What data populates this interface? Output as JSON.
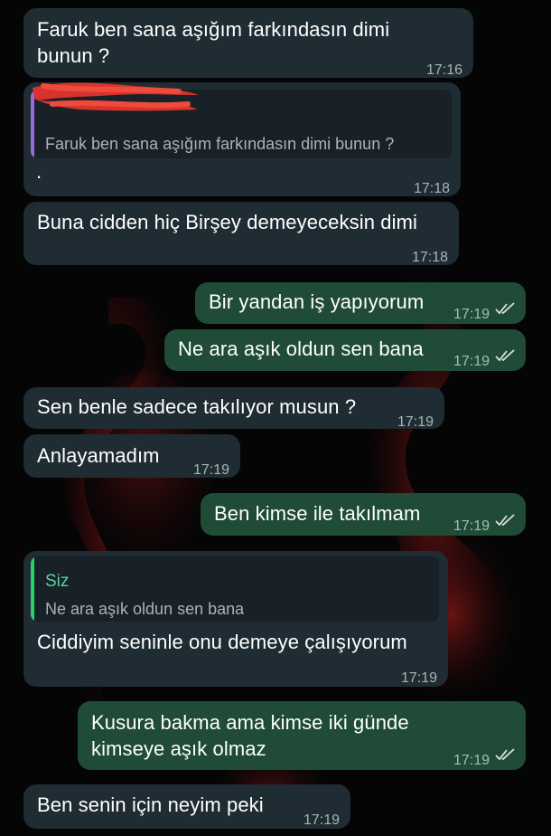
{
  "messages": [
    {
      "id": "m1",
      "direction": "incoming",
      "text": "Faruk ben sana aşığım farkındasın dimi\nbunun ?",
      "time": "17:16"
    },
    {
      "id": "m2",
      "direction": "incoming",
      "reply_quote": {
        "author": "",
        "text": "Faruk ben sana aşığım farkındasın dimi bunun ?",
        "bar_color": "#9b6bdc"
      },
      "text": ".",
      "time": "17:18"
    },
    {
      "id": "m3",
      "direction": "incoming",
      "text": "Buna cidden hiç Birşey demeyeceksin dimi",
      "time": "17:18"
    },
    {
      "id": "m4",
      "direction": "outgoing",
      "text": "Bir yandan iş yapıyorum",
      "time": "17:19",
      "status": "read"
    },
    {
      "id": "m5",
      "direction": "outgoing",
      "text": "Ne ara aşık oldun sen bana",
      "time": "17:19",
      "status": "read"
    },
    {
      "id": "m6",
      "direction": "incoming",
      "text": "Sen benle sadece takılıyor musun ?",
      "time": "17:19"
    },
    {
      "id": "m7",
      "direction": "incoming",
      "text": "Anlayamadım",
      "time": "17:19"
    },
    {
      "id": "m8",
      "direction": "outgoing",
      "text": "Ben kimse ile takılmam",
      "time": "17:19",
      "status": "read"
    },
    {
      "id": "m9",
      "direction": "incoming",
      "reply_quote": {
        "author": "Siz",
        "text": "Ne ara aşık oldun sen bana",
        "bar_color": "#25d366"
      },
      "text": "Ciddiyim seninle onu demeye çalışıyorum",
      "time": "17:19"
    },
    {
      "id": "m10",
      "direction": "outgoing",
      "text": "Kusura bakma ama kimse iki günde\nkimseye aşık olmaz",
      "time": "17:19",
      "status": "read"
    },
    {
      "id": "m11",
      "direction": "incoming",
      "text": "Ben senin için neyim peki",
      "time": "17:19"
    }
  ],
  "colors": {
    "incoming_bubble": "#1f2c33",
    "outgoing_bubble": "#1f4b37",
    "read_ticks": "#d8e2e0",
    "redaction": "#e8352c"
  }
}
